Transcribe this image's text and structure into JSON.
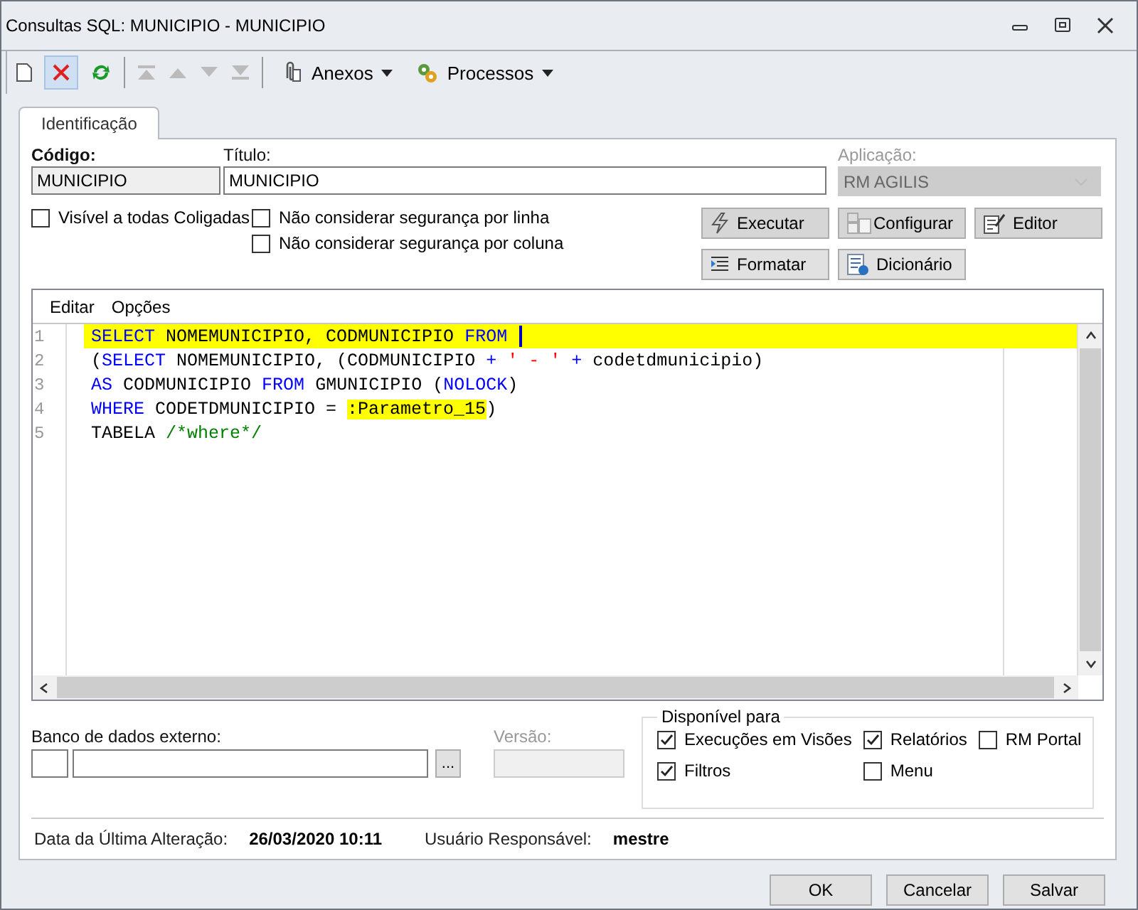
{
  "window": {
    "title": "Consultas SQL: MUNICIPIO - MUNICIPIO"
  },
  "toolbar": {
    "attachments": "Anexos",
    "processes": "Processos"
  },
  "tabs": [
    {
      "label": "Identificação",
      "selected": true
    }
  ],
  "codigo": {
    "label": "Código:",
    "value": "MUNICIPIO"
  },
  "titulo": {
    "label": "Título:",
    "value": "MUNICIPIO"
  },
  "aplicacao": {
    "label": "Aplicação:",
    "value": "RM AGILIS",
    "disabled": true
  },
  "options": [
    {
      "label": "Visível a todas Coligadas",
      "checked": false
    },
    {
      "label": "Não considerar segurança por linha",
      "checked": false
    },
    {
      "label": "Não considerar segurança por coluna",
      "checked": false
    }
  ],
  "actions": [
    {
      "label": "Executar",
      "kind": "bolt"
    },
    {
      "label": "Configurar",
      "kind": "config"
    },
    {
      "label": "Editor",
      "kind": "editor"
    },
    {
      "label": "Formatar",
      "kind": "format"
    },
    {
      "label": "Dicionário",
      "kind": "dictionary"
    }
  ],
  "editor": {
    "menu": [
      "Editar",
      "Opções"
    ],
    "lines": [
      {
        "number": "1",
        "highlighted": true,
        "tokens": [
          {
            "kind": "keyword",
            "text": "SELECT"
          },
          {
            "kind": "plain",
            "text": " NOMEMUNICIPIO, CODMUNICIPIO "
          },
          {
            "kind": "keyword",
            "text": "FROM"
          }
        ]
      },
      {
        "number": "2",
        "highlighted": false,
        "tokens": [
          {
            "kind": "plain",
            "text": "("
          },
          {
            "kind": "keyword",
            "text": "SELECT"
          },
          {
            "kind": "plain",
            "text": " NOMEMUNICIPIO, (CODMUNICIPIO "
          },
          {
            "kind": "operator",
            "text": "+"
          },
          {
            "kind": "string",
            "text": " ' - ' "
          },
          {
            "kind": "operator",
            "text": "+"
          },
          {
            "kind": "plain",
            "text": " codetdmunicipio)"
          }
        ]
      },
      {
        "number": "3",
        "highlighted": false,
        "tokens": [
          {
            "kind": "keyword",
            "text": "AS"
          },
          {
            "kind": "plain",
            "text": " CODMUNICIPIO "
          },
          {
            "kind": "keyword",
            "text": "FROM"
          },
          {
            "kind": "plain",
            "text": " GMUNICIPIO ("
          },
          {
            "kind": "keyword",
            "text": "NOLOCK"
          },
          {
            "kind": "plain",
            "text": ")"
          }
        ]
      },
      {
        "number": "4",
        "highlighted": false,
        "tokens": [
          {
            "kind": "keyword",
            "text": "WHERE"
          },
          {
            "kind": "plain",
            "text": " CODETDMUNICIPIO = "
          },
          {
            "kind": "param",
            "text": ":Parametro_15"
          },
          {
            "kind": "plain",
            "text": ")"
          }
        ]
      },
      {
        "number": "5",
        "highlighted": false,
        "tokens": [
          {
            "kind": "plain",
            "text": "TABELA "
          },
          {
            "kind": "comment",
            "text": "/*where*/"
          }
        ]
      }
    ]
  },
  "banco": {
    "label": "Banco de dados externo:",
    "browse": "..."
  },
  "versao": {
    "label": "Versão:",
    "disabled": true
  },
  "disponivel": {
    "title": "Disponível para",
    "columns": [
      [
        {
          "label": "Execuções em Visões",
          "checked": true
        },
        {
          "label": "Filtros",
          "checked": true
        }
      ],
      [
        {
          "label": "Relatórios",
          "checked": true
        },
        {
          "label": "Menu",
          "checked": false
        }
      ],
      [
        {
          "label": "RM Portal",
          "checked": false
        }
      ]
    ]
  },
  "footer": {
    "date_label": "Data da Última Alteração:",
    "date_value": "26/03/2020 10:11",
    "user_label": "Usuário Responsável:",
    "user_value": "mestre"
  },
  "buttons": [
    "OK",
    "Cancelar",
    "Salvar"
  ]
}
